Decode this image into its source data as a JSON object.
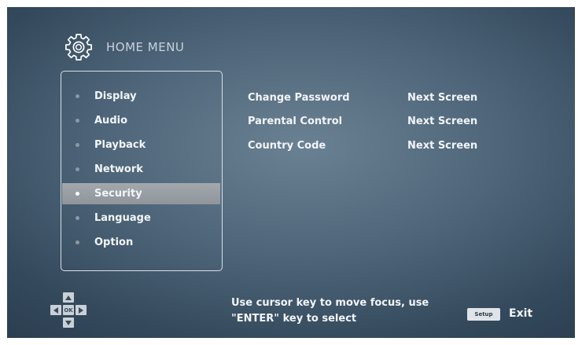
{
  "header": {
    "title": "HOME MENU",
    "icon": "gear-icon"
  },
  "menu": {
    "items": [
      {
        "label": "Display"
      },
      {
        "label": "Audio"
      },
      {
        "label": "Playback"
      },
      {
        "label": "Network"
      },
      {
        "label": "Security",
        "selected": true
      },
      {
        "label": "Language"
      },
      {
        "label": "Option"
      }
    ]
  },
  "options": [
    {
      "name": "Change Password",
      "value": "Next Screen"
    },
    {
      "name": "Parental Control",
      "value": "Next Screen"
    },
    {
      "name": "Country Code",
      "value": "Next Screen"
    }
  ],
  "footer": {
    "ok_key": "OK",
    "hint_line1": "Use cursor key to move focus, use",
    "hint_line2": "\"ENTER\" key to select",
    "setup_key": "Setup",
    "exit_label": "Exit"
  },
  "colors": {
    "background": "#4e6579",
    "selected_row": "#9aa0a6",
    "text": "#f2f5f8"
  }
}
